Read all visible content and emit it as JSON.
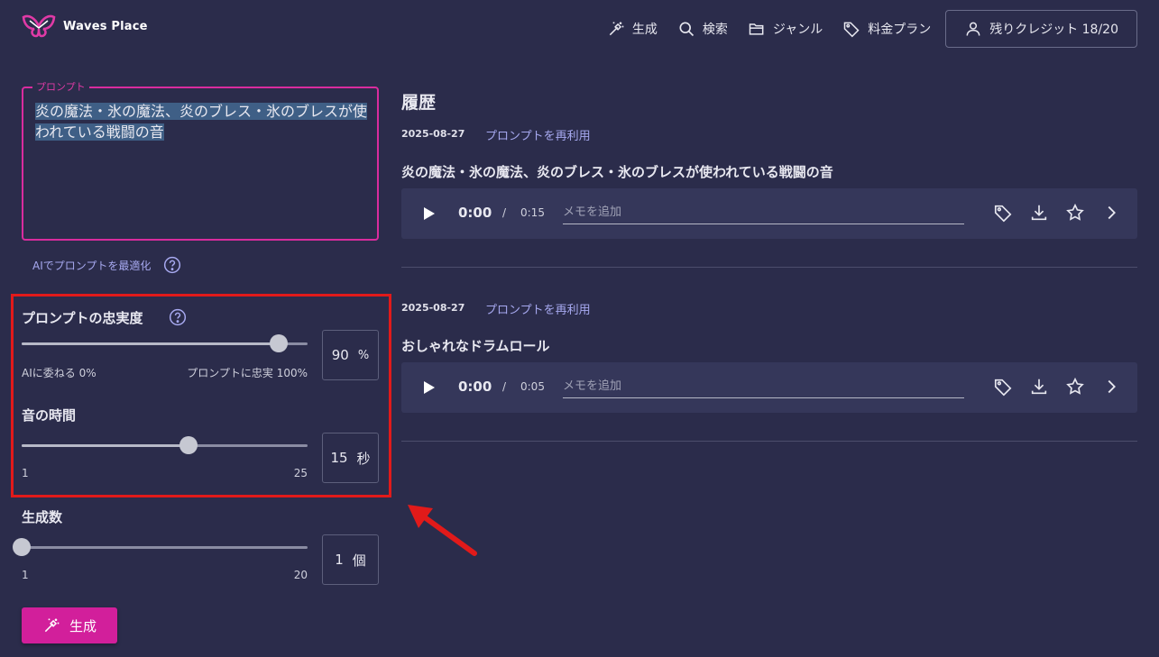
{
  "header": {
    "brand": "Waves Place",
    "nav": [
      {
        "label": "生成",
        "icon": "magic-wand-icon"
      },
      {
        "label": "検索",
        "icon": "search-icon"
      },
      {
        "label": "ジャンル",
        "icon": "folder-icon"
      },
      {
        "label": "料金プラン",
        "icon": "tag-icon"
      }
    ],
    "credits_label": "残りクレジット 18/20"
  },
  "prompt": {
    "legend": "プロンプト",
    "text": "炎の魔法・氷の魔法、炎のブレス・氷のブレスが使われている戦闘の音",
    "optimize_label": "AIでプロンプトを最適化"
  },
  "fidelity": {
    "label": "プロンプトの忠実度",
    "min_label": "AIに委ねる 0%",
    "max_label": "プロンプトに忠実 100%",
    "value": "90",
    "unit": "%",
    "fraction": 0.9
  },
  "duration": {
    "label": "音の時間",
    "min_label": "1",
    "max_label": "25",
    "value": "15",
    "unit": "秒",
    "fraction": 0.583
  },
  "count": {
    "label": "生成数",
    "min_label": "1",
    "max_label": "20",
    "value": "1",
    "unit": "個",
    "fraction": 0.0
  },
  "generate_button": "生成",
  "history": {
    "title": "履歴",
    "entries": [
      {
        "date": "2025-08-27",
        "reuse": "プロンプトを再利用",
        "title": "炎の魔法・氷の魔法、炎のブレス・氷のブレスが使われている戦闘の音",
        "current": "0:00",
        "sep": "/",
        "total": "0:15",
        "memo_placeholder": "メモを追加"
      },
      {
        "date": "2025-08-27",
        "reuse": "プロンプトを再利用",
        "title": "おしゃれなドラムロール",
        "current": "0:00",
        "sep": "/",
        "total": "0:05",
        "memo_placeholder": "メモを追加"
      }
    ]
  },
  "colors": {
    "background": "#2b2c4b",
    "accent": "#d21f9b",
    "link": "#a7a9f0",
    "highlight": "#e11a1a"
  }
}
